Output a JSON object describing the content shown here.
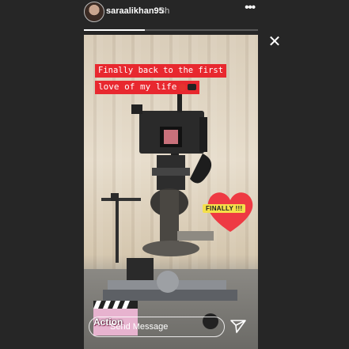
{
  "header": {
    "username": "saraalikhan95",
    "time": "3h",
    "more_icon": "more-horizontal-icon"
  },
  "story": {
    "progress": 0.35,
    "caption": {
      "line1": "Finally back to the first",
      "line2": "love of my life"
    },
    "stickers": {
      "heart_label": "FINALLY !!!",
      "gif_label": "Action"
    }
  },
  "reply": {
    "placeholder": "Send Message"
  },
  "colors": {
    "background": "#262626",
    "caption_bg": "#e8282f",
    "heart": "#ee3a43",
    "sticker_label_bg": "#f4e04a"
  }
}
